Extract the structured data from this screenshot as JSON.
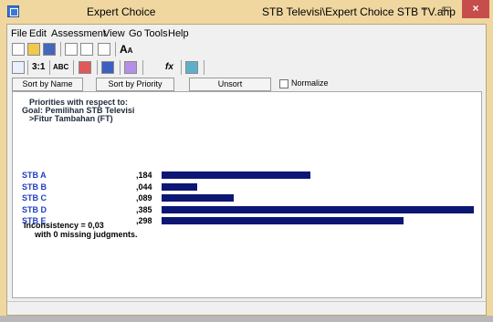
{
  "window": {
    "app_title": "Expert Choice",
    "file_title": "STB Televisi\\Expert Choice STB TV.ahp",
    "minimize_glyph": "–",
    "maximize_glyph": "▭",
    "close_glyph": "×"
  },
  "menu": [
    "File",
    "Edit",
    "Assessment",
    "View",
    "Go",
    "Tools",
    "Help"
  ],
  "toolbar": {
    "new_icon": "new-file-icon",
    "open_icon": "open-folder-icon",
    "save_icon": "save-icon",
    "print_icon": "print-icon",
    "preview_icon": "print-preview-icon",
    "tree_icon": "tree-icon",
    "font_icon": "font-size-icon",
    "tabs": [
      "3:1",
      "ABC"
    ],
    "formula_label": "fx"
  },
  "sort": {
    "by_name": "Sort by Name",
    "by_priority": "Sort by Priority",
    "unsort": "Unsort",
    "normalize": "Normalize"
  },
  "report": {
    "line1": "Priorities with respect to:",
    "line2": "Goal: Pemilihan STB Televisi",
    "line3": ">Fitur Tambahan (FT)"
  },
  "rows": [
    {
      "label": "STB A",
      "value": ",184",
      "share": 0.184
    },
    {
      "label": "STB B",
      "value": ",044",
      "share": 0.044
    },
    {
      "label": "STB C",
      "value": ",089",
      "share": 0.089
    },
    {
      "label": "STB D",
      "value": ",385",
      "share": 0.385
    },
    {
      "label": "STB E",
      "value": ",298",
      "share": 0.298
    }
  ],
  "inconsistency": "Inconsistency = 0,03",
  "missing": "with 0  missing judgments.",
  "colors": {
    "bar": "#0c1674",
    "label": "#1f3fbf",
    "title_bar": "#f0d7a0",
    "close": "#c74d4d"
  }
}
